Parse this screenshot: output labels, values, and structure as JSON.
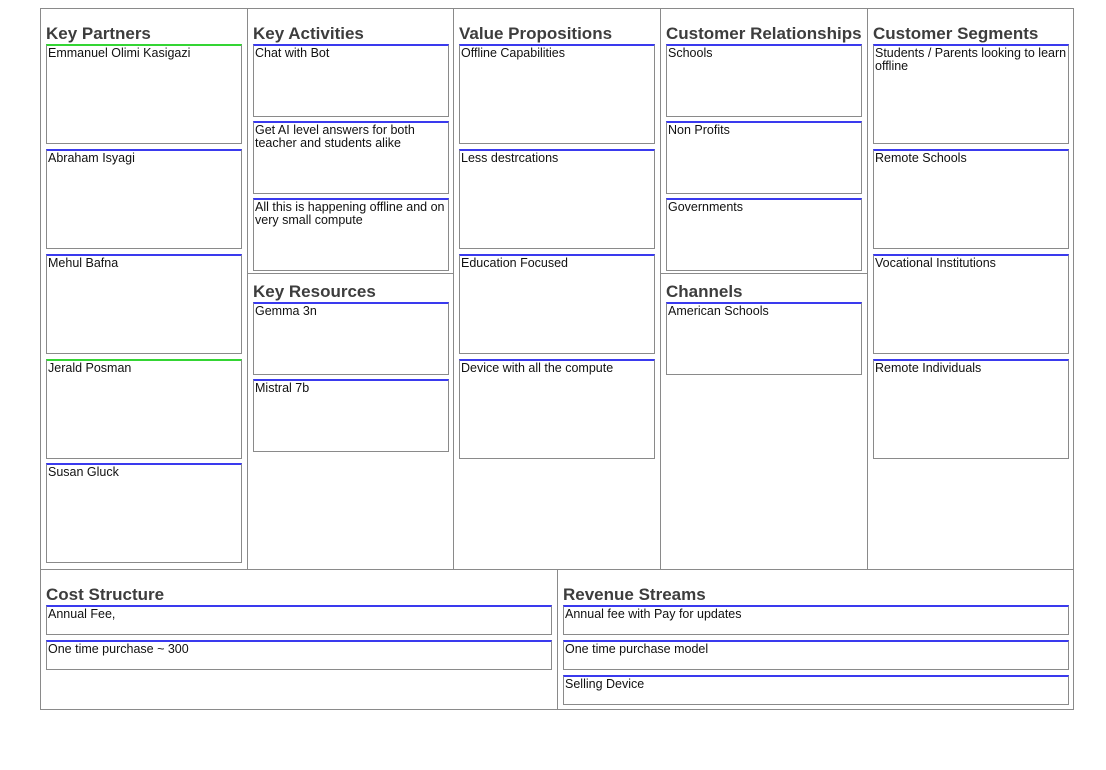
{
  "key_partners": {
    "title": "Key Partners",
    "notes": [
      "Emmanuel Olimi Kasigazi",
      "Abraham Isyagi",
      "Mehul Bafna",
      "Jerald Posman",
      "Susan Gluck"
    ]
  },
  "key_activities": {
    "title": "Key Activities",
    "notes": [
      "Chat with Bot",
      "Get AI level answers for both teacher and students alike",
      "All this is happening offline and on very small compute"
    ]
  },
  "key_resources": {
    "title": "Key Resources",
    "notes": [
      "Gemma 3n",
      "Mistral 7b"
    ]
  },
  "value_propositions": {
    "title": "Value Propositions",
    "notes": [
      "Offline Capabilities",
      "Less destrcations",
      "Education Focused",
      "Device with all the compute"
    ]
  },
  "customer_relationships": {
    "title": "Customer Relationships",
    "notes": [
      "Schools",
      "Non Profits",
      "Governments"
    ]
  },
  "channels": {
    "title": "Channels",
    "notes": [
      "American Schools"
    ]
  },
  "customer_segments": {
    "title": "Customer Segments",
    "notes": [
      "Students / Parents  looking to learn offline",
      "Remote Schools",
      "Vocational Institutions",
      "Remote Individuals"
    ]
  },
  "cost_structure": {
    "title": "Cost Structure",
    "notes": [
      "Annual Fee,",
      "One time purchase ~ 300"
    ]
  },
  "revenue_streams": {
    "title": "Revenue Streams",
    "notes": [
      "Annual fee with Pay for updates",
      "One time purchase model",
      "Selling Device"
    ]
  },
  "colors": {
    "note_top_blue": "#3a3aee",
    "note_top_green": "#34d534",
    "grid_line": "#8a8a8a",
    "heading_text": "#3d3d3d"
  }
}
